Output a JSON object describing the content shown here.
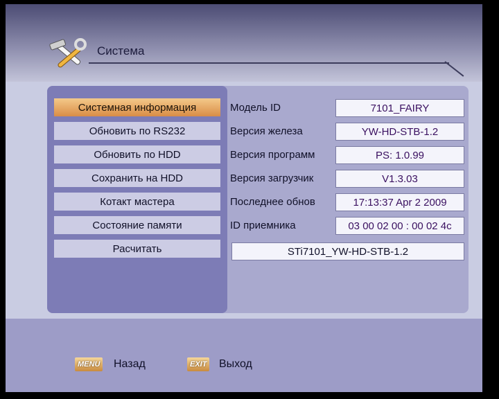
{
  "header": {
    "title": "Система",
    "icon": "tools-icon"
  },
  "menu": {
    "selected_index": 0,
    "items": [
      "Системная информация",
      "Обновить по RS232",
      "Обновить по HDD",
      "Сохранить на HDD",
      "Котакт мастера",
      "Состояние памяти",
      "Расчитать"
    ]
  },
  "info": {
    "rows": [
      {
        "label": "Модель ID",
        "value": "7101_FAIRY"
      },
      {
        "label": "Версия железа",
        "value": "YW-HD-STB-1.2"
      },
      {
        "label": "Версия программ",
        "value": "PS: 1.0.99"
      },
      {
        "label": "Версия загрузчик",
        "value": "V1.3.03"
      },
      {
        "label": "Последнее обнов",
        "value": "17:13:37 Apr  2 2009"
      },
      {
        "label": "ID приемника",
        "value": "03 00 02 00 : 00 02 4c"
      }
    ],
    "full_name": "STi7101_YW-HD-STB-1.2"
  },
  "footer": {
    "menu_key": "MENU",
    "menu_label": "Назад",
    "exit_key": "EXIT",
    "exit_label": "Выход"
  },
  "colors": {
    "selected_gradient_top": "#f4c98a",
    "selected_gradient_bottom": "#d98d46",
    "panel": "#7d7cb6",
    "item": "#cccce4"
  }
}
